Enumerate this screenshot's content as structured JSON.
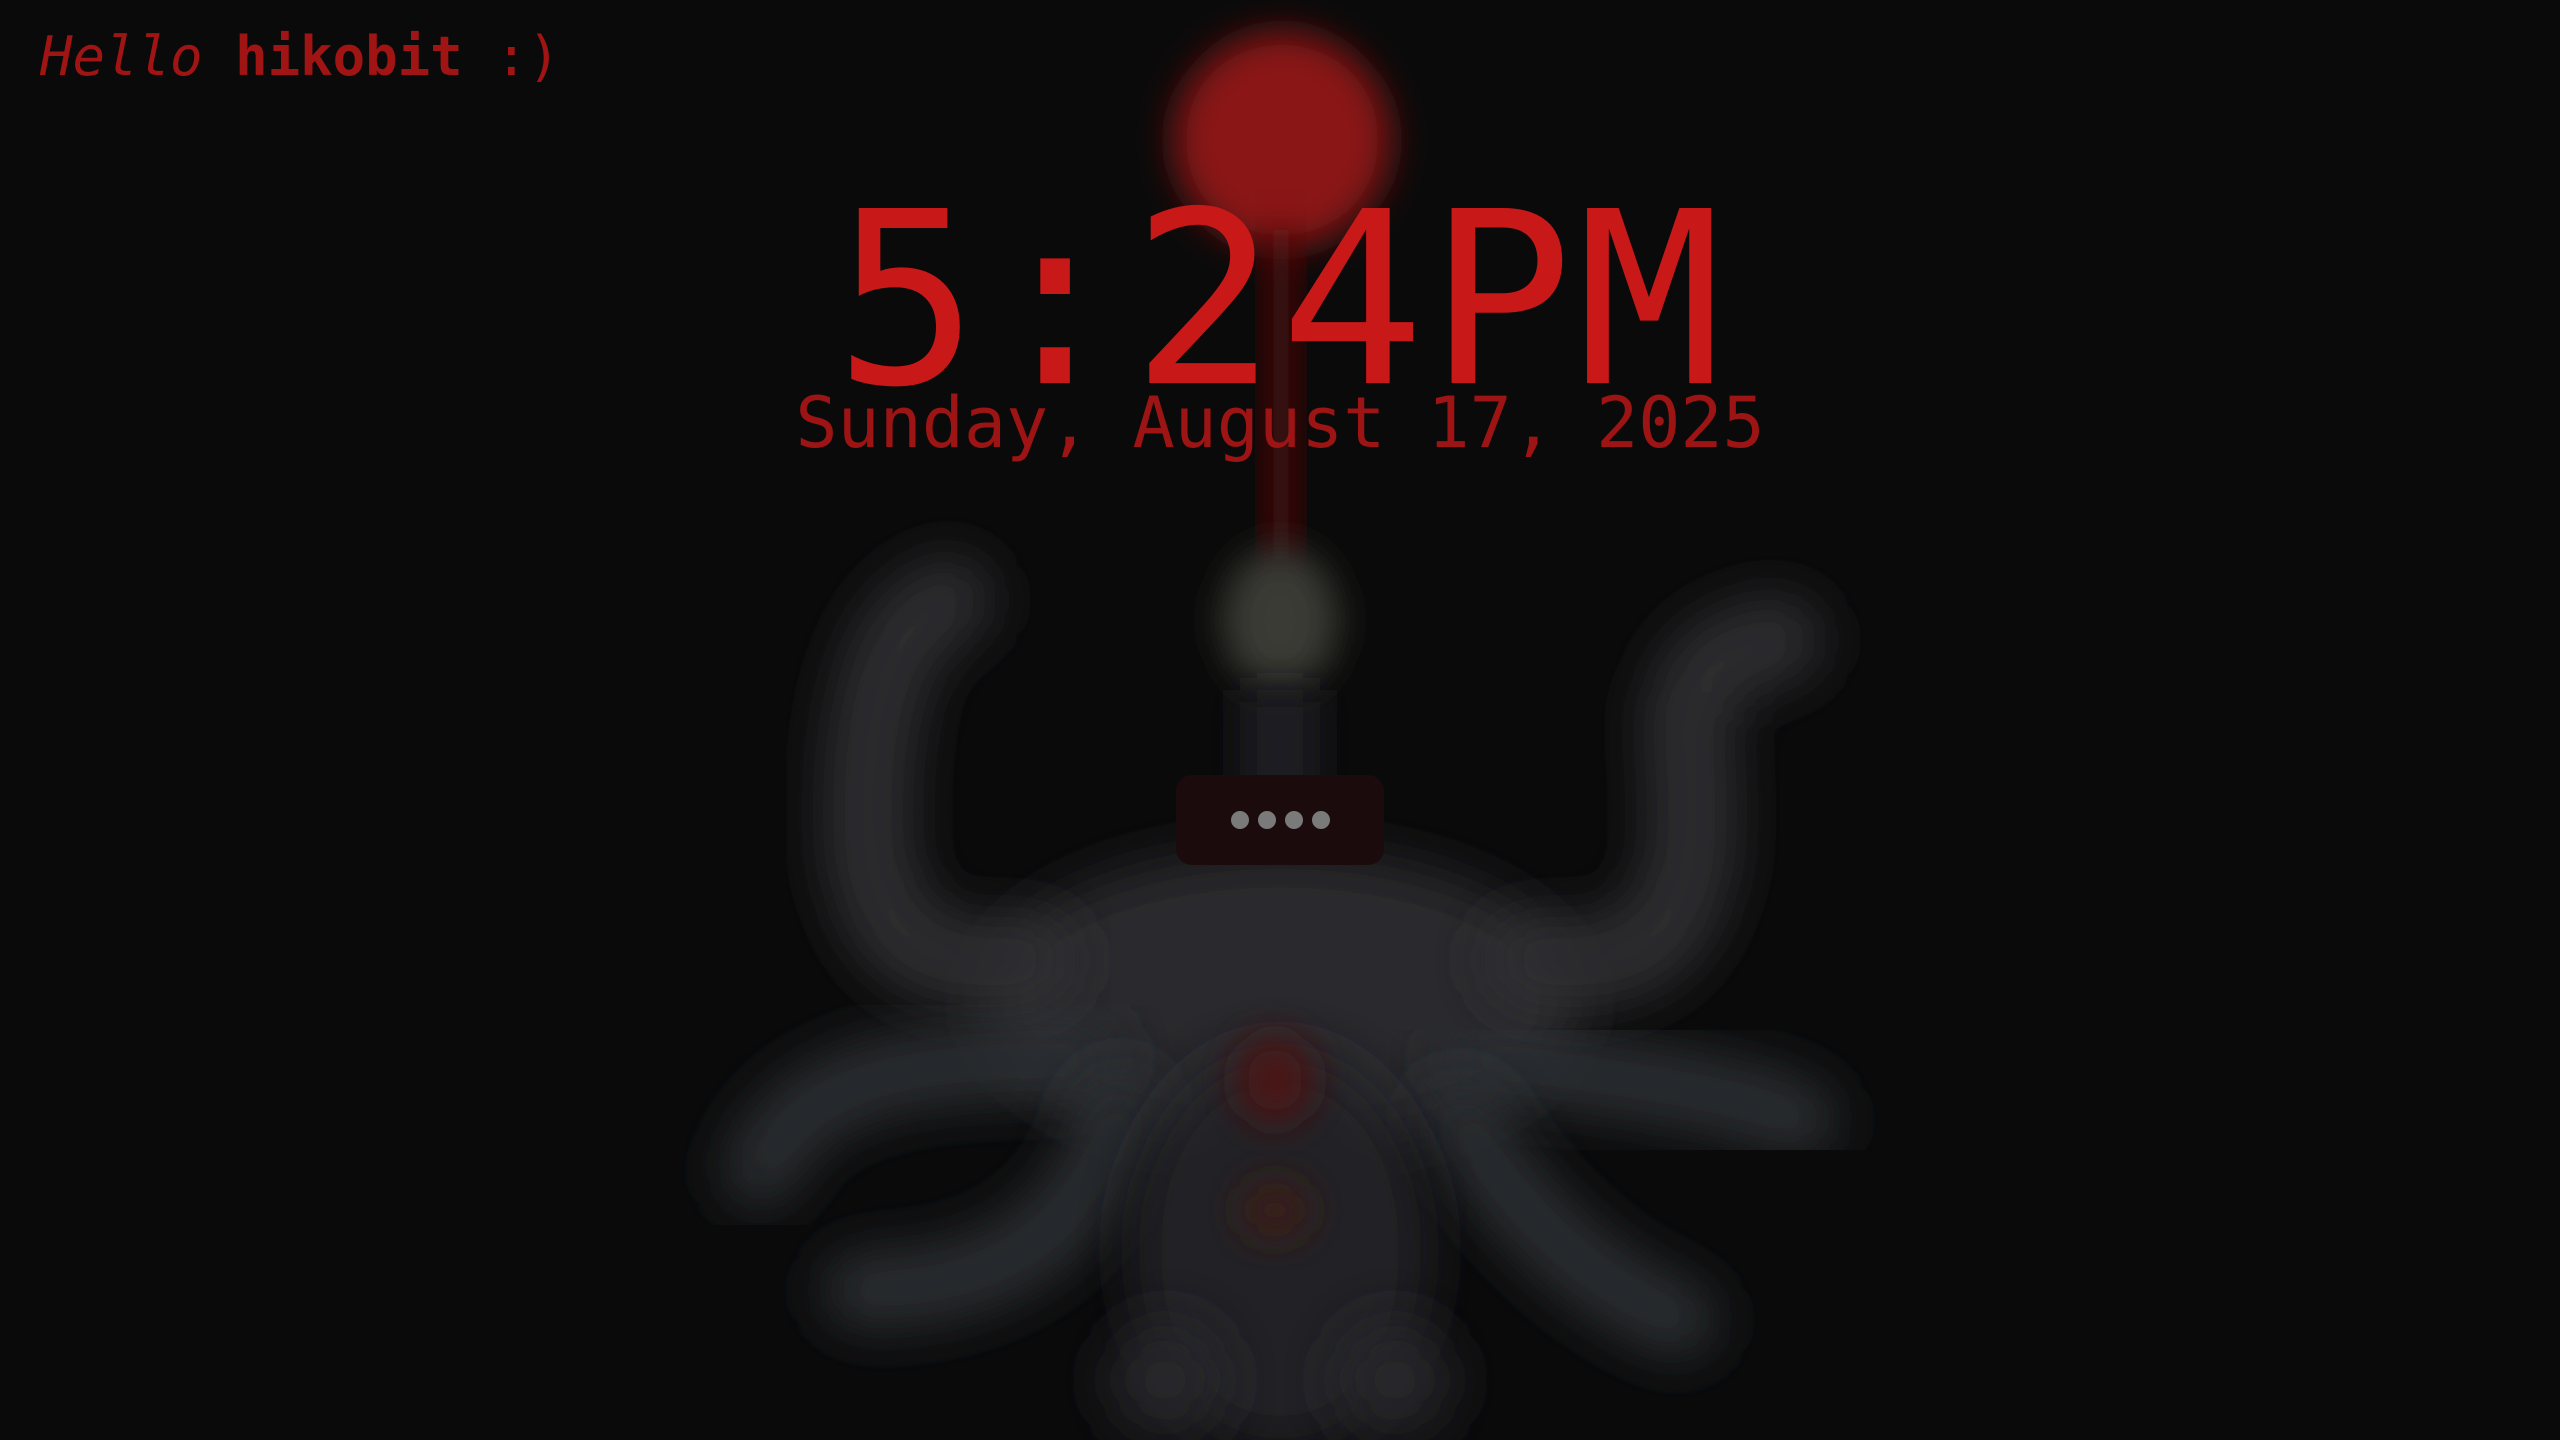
{
  "greeting": {
    "word": "Hello",
    "username": "hikobit",
    "emoticon": ":)"
  },
  "clock": {
    "time": "5:24PM",
    "date": "Sunday, August 17, 2025"
  },
  "password": {
    "masked_length": 4
  },
  "colors": {
    "accent": "#c91818",
    "accent_dim": "#9c1414",
    "background": "#0a0a0a",
    "field_background": "#1b0b0c",
    "mask_dot": "#7a7a7a"
  },
  "wallpaper": {
    "description_icon": "blurred-creature-wallpaper"
  }
}
